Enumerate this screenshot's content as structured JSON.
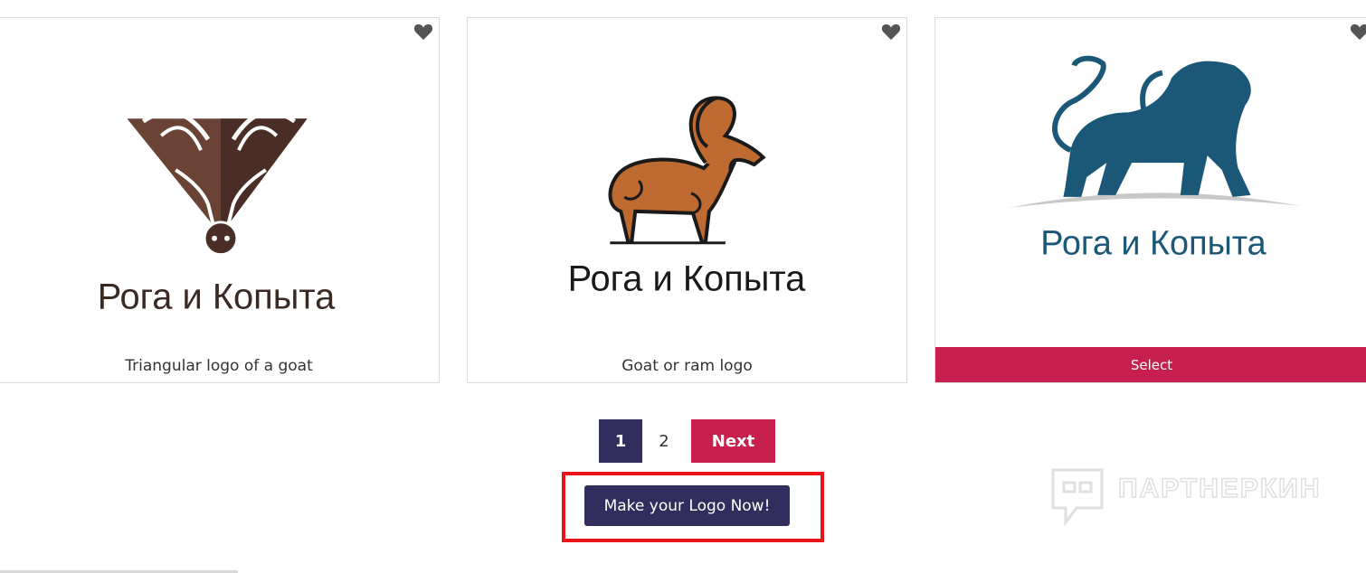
{
  "cards": [
    {
      "logo_text": "Рога и Копыта",
      "caption": "Triangular logo of a goat",
      "heart_icon": "heart-icon",
      "colors": {
        "primary": "#5b3a2c",
        "text": "#3a2a24"
      }
    },
    {
      "logo_text": "Рога и Копыта",
      "caption": "Goat or ram logo",
      "heart_icon": "heart-icon",
      "colors": {
        "primary": "#bf6a30",
        "text": "#1a1a1a"
      }
    },
    {
      "logo_text": "Рога и Копыта",
      "select_label": "Select",
      "heart_icon": "heart-icon",
      "colors": {
        "primary": "#1b5878",
        "text": "#1b5878"
      }
    }
  ],
  "pagination": {
    "pages": [
      "1",
      "2"
    ],
    "current": "1",
    "next_label": "Next"
  },
  "cta": {
    "label": "Make your Logo Now!"
  },
  "watermark": {
    "text": "ПАРТНЕРКИН"
  },
  "colors": {
    "accent": "#c71f4e",
    "dark": "#312d5c",
    "highlight": "#e8131b"
  }
}
